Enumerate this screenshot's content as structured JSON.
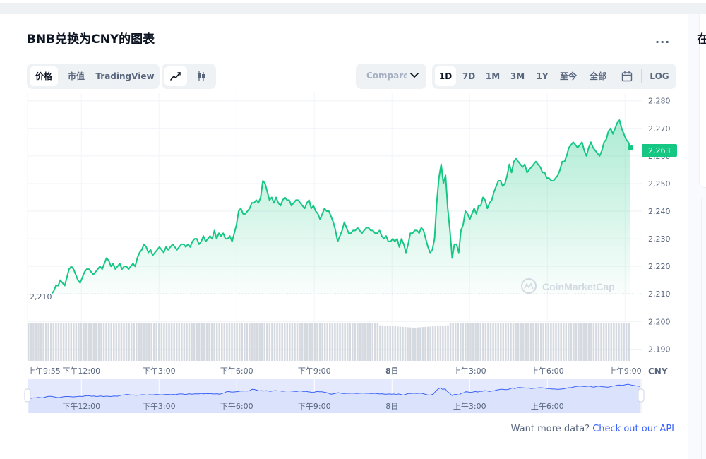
{
  "page": {
    "title": "BNB兑换为CNY的图表",
    "more_label": "...",
    "side_title": "在"
  },
  "toolbar": {
    "view_tabs": [
      {
        "label": "价格",
        "active": true
      },
      {
        "label": "市值",
        "active": false
      },
      {
        "label": "TradingView",
        "active": false
      }
    ],
    "chart_types": [
      {
        "icon": "line-chart-icon",
        "active": true
      },
      {
        "icon": "candlestick-icon",
        "active": false
      }
    ],
    "compare_label": "Compare with",
    "ranges": [
      {
        "label": "1D",
        "active": true
      },
      {
        "label": "7D",
        "active": false
      },
      {
        "label": "1M",
        "active": false
      },
      {
        "label": "3M",
        "active": false
      },
      {
        "label": "1Y",
        "active": false
      },
      {
        "label": "至今",
        "active": false
      },
      {
        "label": "全部",
        "active": false
      }
    ],
    "calendar_icon": "calendar-icon",
    "log_label": "LOG"
  },
  "chart_data": {
    "type": "area",
    "title": "BNB兑换为CNY的图表",
    "currency_label": "CNY",
    "watermark": "CoinMarketCap",
    "y_ticks": [
      2280,
      2270,
      2260,
      2250,
      2240,
      2230,
      2220,
      2210,
      2200,
      2190
    ],
    "ylim": [
      2186,
      2283
    ],
    "open_value": 2210,
    "open_label": "2,210",
    "current_value": 2263,
    "current_label": "2,263",
    "x_tick_labels": [
      "上午9:55",
      "下午12:00",
      "下午3:00",
      "下午6:00",
      "下午9:00",
      "8日",
      "上午3:00",
      "上午6:00",
      "上午9:00"
    ],
    "x_tick_hours": [
      0,
      2.08,
      5.08,
      8.08,
      11.08,
      14.08,
      17.08,
      20.08,
      23.08
    ],
    "x_range_hours": [
      0,
      23.4
    ],
    "series": [
      {
        "values": [
          2210,
          2211,
          2213,
          2213,
          2215,
          2214,
          2213,
          2216,
          2219,
          2220,
          2219,
          2217,
          2215,
          2214,
          2216,
          2218,
          2219,
          2219,
          2218,
          2217,
          2218,
          2219,
          2220,
          2219,
          2221,
          2223,
          2222,
          2220,
          2221,
          2219,
          2220,
          2221,
          2219,
          2220,
          2220,
          2219,
          2220,
          2221,
          2220,
          2223,
          2225,
          2226,
          2228,
          2227,
          2225,
          2226,
          2224,
          2225,
          2226,
          2227,
          2226,
          2225,
          2227,
          2226,
          2227,
          2228,
          2227,
          2226,
          2227,
          2228,
          2228,
          2227,
          2228,
          2227,
          2229,
          2230,
          2230,
          2228,
          2229,
          2231,
          2229,
          2230,
          2231,
          2230,
          2233,
          2230,
          2232,
          2231,
          2232,
          2230,
          2230,
          2231,
          2229,
          2232,
          2235,
          2240,
          2241,
          2239,
          2239,
          2240,
          2241,
          2243,
          2243,
          2244,
          2243,
          2245,
          2251,
          2250,
          2247,
          2244,
          2245,
          2243,
          2245,
          2243,
          2242,
          2244,
          2245,
          2244,
          2244,
          2242,
          2243,
          2244,
          2244,
          2243,
          2242,
          2241,
          2243,
          2244,
          2241,
          2242,
          2240,
          2239,
          2237,
          2239,
          2241,
          2240,
          2240,
          2238,
          2236,
          2233,
          2229,
          2231,
          2233,
          2236,
          2234,
          2232,
          2232,
          2233,
          2233,
          2234,
          2233,
          2232,
          2233,
          2234,
          2234,
          2233,
          2233,
          2232,
          2232,
          2233,
          2231,
          2230,
          2231,
          2229,
          2229,
          2230,
          2229,
          2230,
          2227,
          2230,
          2228,
          2225,
          2228,
          2232,
          2232,
          2233,
          2233,
          2232,
          2234,
          2233,
          2230,
          2227,
          2225,
          2226,
          2230,
          2243,
          2252,
          2257,
          2250,
          2253,
          2241,
          2233,
          2223,
          2228,
          2228,
          2225,
          2233,
          2235,
          2240,
          2239,
          2237,
          2239,
          2241,
          2239,
          2242,
          2242,
          2245,
          2244,
          2241,
          2243,
          2244,
          2247,
          2249,
          2251,
          2251,
          2249,
          2250,
          2253,
          2257,
          2254,
          2258,
          2259,
          2258,
          2257,
          2256,
          2257,
          2254,
          2255,
          2256,
          2257,
          2258,
          2257,
          2256,
          2254,
          2254,
          2252,
          2252,
          2251,
          2251,
          2252,
          2253,
          2255,
          2258,
          2258,
          2260,
          2263,
          2264,
          2265,
          2264,
          2263,
          2264,
          2265,
          2262,
          2260,
          2263,
          2265,
          2263,
          2262,
          2261,
          2260,
          2262,
          2265,
          2266,
          2269,
          2270,
          2268,
          2270,
          2272,
          2273,
          2270,
          2268,
          2266,
          2265,
          2263
        ]
      }
    ],
    "volume_bars": 240
  },
  "navigator": {
    "x_labels": [
      "下午12:00",
      "下午3:00",
      "下午6:00",
      "下午9:00",
      "8日",
      "上午3:00",
      "上午6:00"
    ]
  },
  "footer": {
    "text": "Want more data?",
    "link": "Check out our API"
  },
  "colors": {
    "line": "#16c784",
    "area_top": "#16c784",
    "volume": "#d5d9e0",
    "nav_line": "#3861fb",
    "nav_fill": "#e4e9fd",
    "accent": "#3861fb"
  }
}
